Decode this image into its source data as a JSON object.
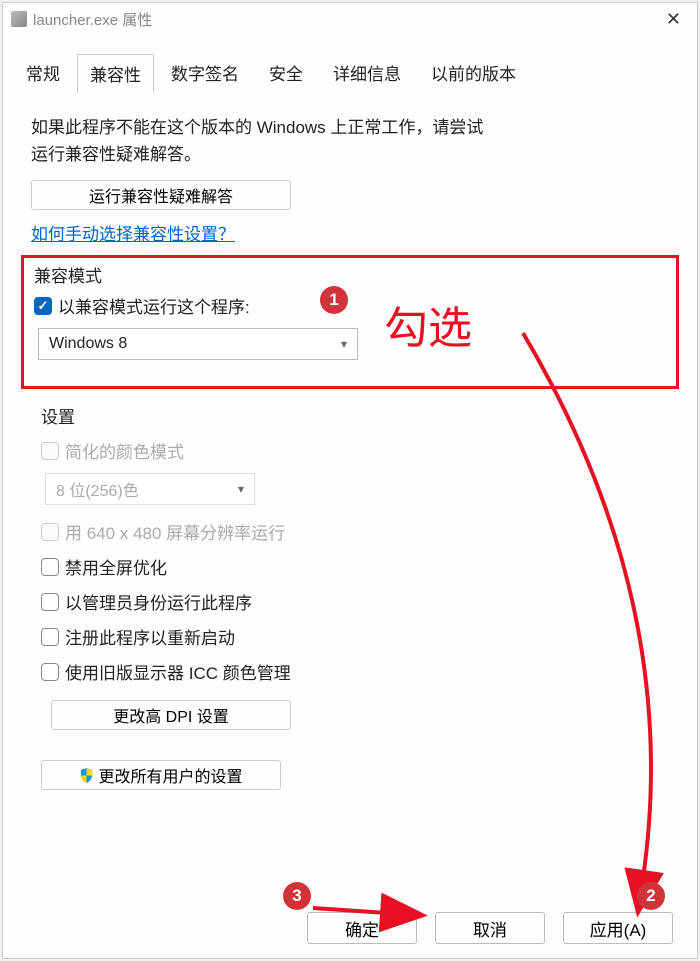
{
  "title": "launcher.exe 属性",
  "tabs": [
    "常规",
    "兼容性",
    "数字签名",
    "安全",
    "详细信息",
    "以前的版本"
  ],
  "active_tab": 1,
  "intro_line1": "如果此程序不能在这个版本的 Windows 上正常工作，请尝试",
  "intro_line2": "运行兼容性疑难解答。",
  "troubleshoot_btn": "运行兼容性疑难解答",
  "link_text": "如何手动选择兼容性设置？",
  "compat_mode": {
    "group_label": "兼容模式",
    "checkbox_label": "以兼容模式运行这个程序:",
    "selected_os": "Windows 8"
  },
  "annotation": {
    "badge1": "1",
    "check_text": "勾选",
    "badge2": "2",
    "badge3": "3"
  },
  "settings": {
    "group_label": "设置",
    "reduced_color": "简化的颜色模式",
    "color_depth": "8 位(256)色",
    "resolution_640": "用 640 x 480 屏幕分辨率运行",
    "disable_fullscreen": "禁用全屏优化",
    "run_admin": "以管理员身份运行此程序",
    "register_restart": "注册此程序以重新启动",
    "legacy_icc": "使用旧版显示器 ICC 颜色管理",
    "dpi_btn": "更改高 DPI 设置"
  },
  "all_users_btn": "更改所有用户的设置",
  "buttons": {
    "ok": "确定",
    "cancel": "取消",
    "apply": "应用(A)"
  }
}
